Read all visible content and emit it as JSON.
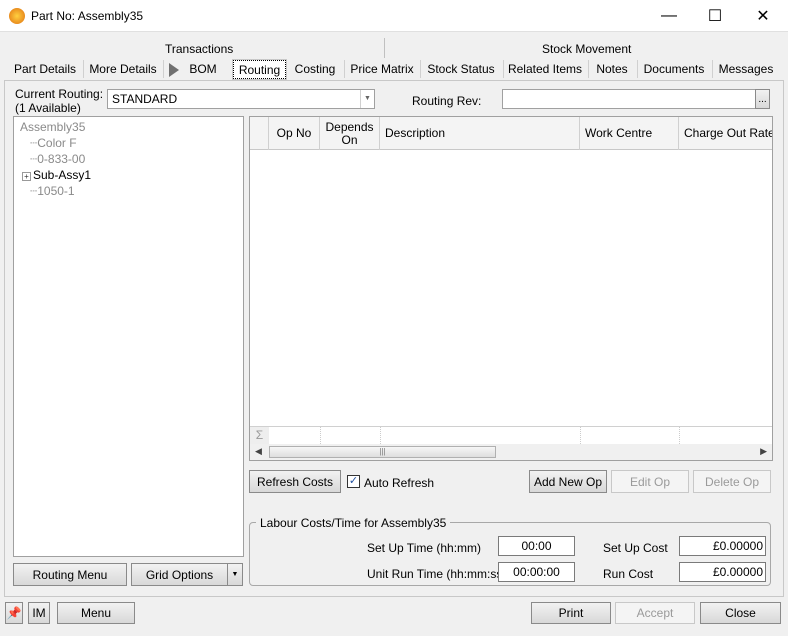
{
  "window": {
    "title": "Part No: Assembly35",
    "minimize": "—",
    "maximize": "☐",
    "close": "✕"
  },
  "tab_groups": {
    "transactions": "Transactions",
    "stock_movement": "Stock Movement"
  },
  "tabs": [
    {
      "label": "Part Details"
    },
    {
      "label": "More Details"
    },
    {
      "label": "BOM"
    },
    {
      "label": "Routing",
      "selected": true
    },
    {
      "label": "Costing"
    },
    {
      "label": "Price Matrix"
    },
    {
      "label": "Stock Status"
    },
    {
      "label": "Related Items"
    },
    {
      "label": "Notes"
    },
    {
      "label": "Documents"
    },
    {
      "label": "Messages"
    }
  ],
  "routing": {
    "label_line1": "Current Routing:",
    "label_line2": "(1 Available)",
    "value": "STANDARD",
    "rev_label": "Routing Rev:",
    "rev_value": "",
    "browse": "..."
  },
  "tree": {
    "root": "Assembly35",
    "items": [
      "Color F",
      "0-833-00",
      "Sub-Assy1",
      "1050-1"
    ]
  },
  "grid": {
    "columns": [
      "Op No",
      "Depends On",
      "Description",
      "Work Centre",
      "Charge Out Rate"
    ],
    "sigma": "Σ",
    "rows": []
  },
  "actions": {
    "refresh_costs": "Refresh Costs",
    "auto_refresh": "Auto Refresh",
    "auto_refresh_checked": true,
    "add_new_op": "Add New Op",
    "edit_op": "Edit Op",
    "delete_op": "Delete Op",
    "routing_menu": "Routing Menu",
    "grid_options": "Grid Options"
  },
  "labour": {
    "title": "Labour Costs/Time for Assembly35",
    "setup_time_label": "Set Up Time (hh:mm)",
    "setup_time": "00:00",
    "run_time_label": "Unit Run Time (hh:mm:ss)",
    "run_time": "00:00:00",
    "setup_cost_label": "Set Up Cost",
    "setup_cost": "£0.00000",
    "run_cost_label": "Run Cost",
    "run_cost": "£0.00000"
  },
  "footer": {
    "im": "IM",
    "menu": "Menu",
    "print": "Print",
    "accept": "Accept",
    "close": "Close"
  }
}
